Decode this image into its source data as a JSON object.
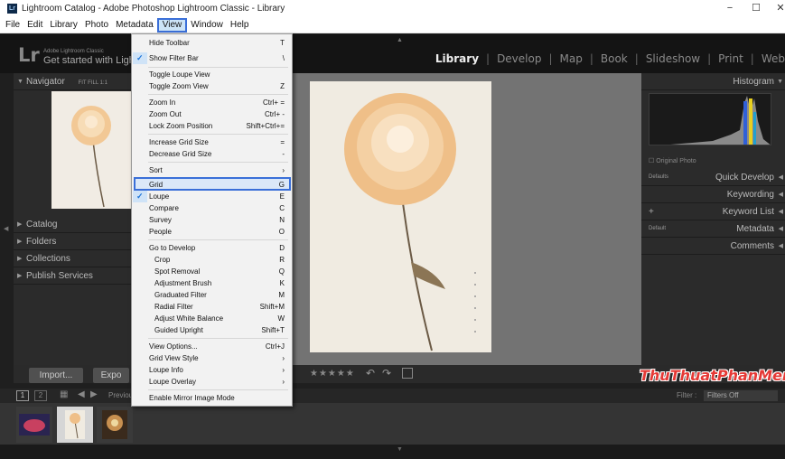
{
  "window": {
    "icon_text": "Lr",
    "title": "Lightroom Catalog - Adobe Photoshop Lightroom Classic - Library",
    "minimize": "−",
    "maximize": "☐",
    "close": "✕"
  },
  "menubar": {
    "items": [
      "File",
      "Edit",
      "Library",
      "Photo",
      "Metadata",
      "View",
      "Window",
      "Help"
    ],
    "active": "View"
  },
  "identity": {
    "logo": "Lr",
    "small": "Adobe Lightroom Classic",
    "main": "Get started with Light"
  },
  "modules": [
    "Library",
    "Develop",
    "Map",
    "Book",
    "Slideshow",
    "Print",
    "Web"
  ],
  "left_panel": {
    "navigator": "Navigator",
    "nav_opts": "FIT  FILL  1:1",
    "sections": [
      "Catalog",
      "Folders",
      "Collections",
      "Publish Services"
    ]
  },
  "right_panel": {
    "histogram": "Histogram",
    "original_photo": "Original Photo",
    "defaults": "Defaults",
    "default": "Default",
    "plus": "+",
    "sections": [
      "Quick Develop",
      "Keywording",
      "Keyword List",
      "Metadata",
      "Comments"
    ]
  },
  "toolbar": {
    "import": "Import...",
    "export": "Expo",
    "stars": "★★★★★"
  },
  "filmstrip": {
    "page1": "1",
    "page2": "2",
    "previous": "Previou",
    "filter_label": "Filter :",
    "filter_value": "Filters Off"
  },
  "watermark": "ThuThuatPhanMem.vn",
  "view_menu": {
    "items": [
      {
        "label": "Hide Toolbar",
        "shortcut": "T",
        "checked": false
      },
      {
        "label": "Show Filter Bar",
        "shortcut": "\\",
        "checked": true
      },
      {
        "label": "Toggle Loupe View",
        "shortcut": "",
        "checked": false
      },
      {
        "label": "Toggle Zoom View",
        "shortcut": "Z",
        "checked": false
      },
      {
        "label": "Zoom In",
        "shortcut": "Ctrl+ =",
        "checked": false
      },
      {
        "label": "Zoom Out",
        "shortcut": "Ctrl+ -",
        "checked": false
      },
      {
        "label": "Lock Zoom Position",
        "shortcut": "Shift+Ctrl+=",
        "checked": false
      },
      {
        "label": "Increase Grid Size",
        "shortcut": "=",
        "checked": false
      },
      {
        "label": "Decrease Grid Size",
        "shortcut": "-",
        "checked": false
      },
      {
        "label": "Sort",
        "shortcut": "›",
        "checked": false
      },
      {
        "label": "Grid",
        "shortcut": "G",
        "checked": false
      },
      {
        "label": "Loupe",
        "shortcut": "E",
        "checked": true
      },
      {
        "label": "Compare",
        "shortcut": "C",
        "checked": false
      },
      {
        "label": "Survey",
        "shortcut": "N",
        "checked": false
      },
      {
        "label": "People",
        "shortcut": "O",
        "checked": false
      },
      {
        "label": "Go to Develop",
        "shortcut": "D",
        "checked": false
      },
      {
        "label": "Crop",
        "shortcut": "R",
        "checked": false
      },
      {
        "label": "Spot Removal",
        "shortcut": "Q",
        "checked": false
      },
      {
        "label": "Adjustment Brush",
        "shortcut": "K",
        "checked": false
      },
      {
        "label": "Graduated Filter",
        "shortcut": "M",
        "checked": false
      },
      {
        "label": "Radial Filter",
        "shortcut": "Shift+M",
        "checked": false
      },
      {
        "label": "Adjust White Balance",
        "shortcut": "W",
        "checked": false
      },
      {
        "label": "Guided Upright",
        "shortcut": "Shift+T",
        "checked": false
      },
      {
        "label": "View Options...",
        "shortcut": "Ctrl+J",
        "checked": false
      },
      {
        "label": "Grid View Style",
        "shortcut": "›",
        "checked": false
      },
      {
        "label": "Loupe Info",
        "shortcut": "›",
        "checked": false
      },
      {
        "label": "Loupe Overlay",
        "shortcut": "›",
        "checked": false
      },
      {
        "label": "Enable Mirror Image Mode",
        "shortcut": "",
        "checked": false
      }
    ]
  }
}
